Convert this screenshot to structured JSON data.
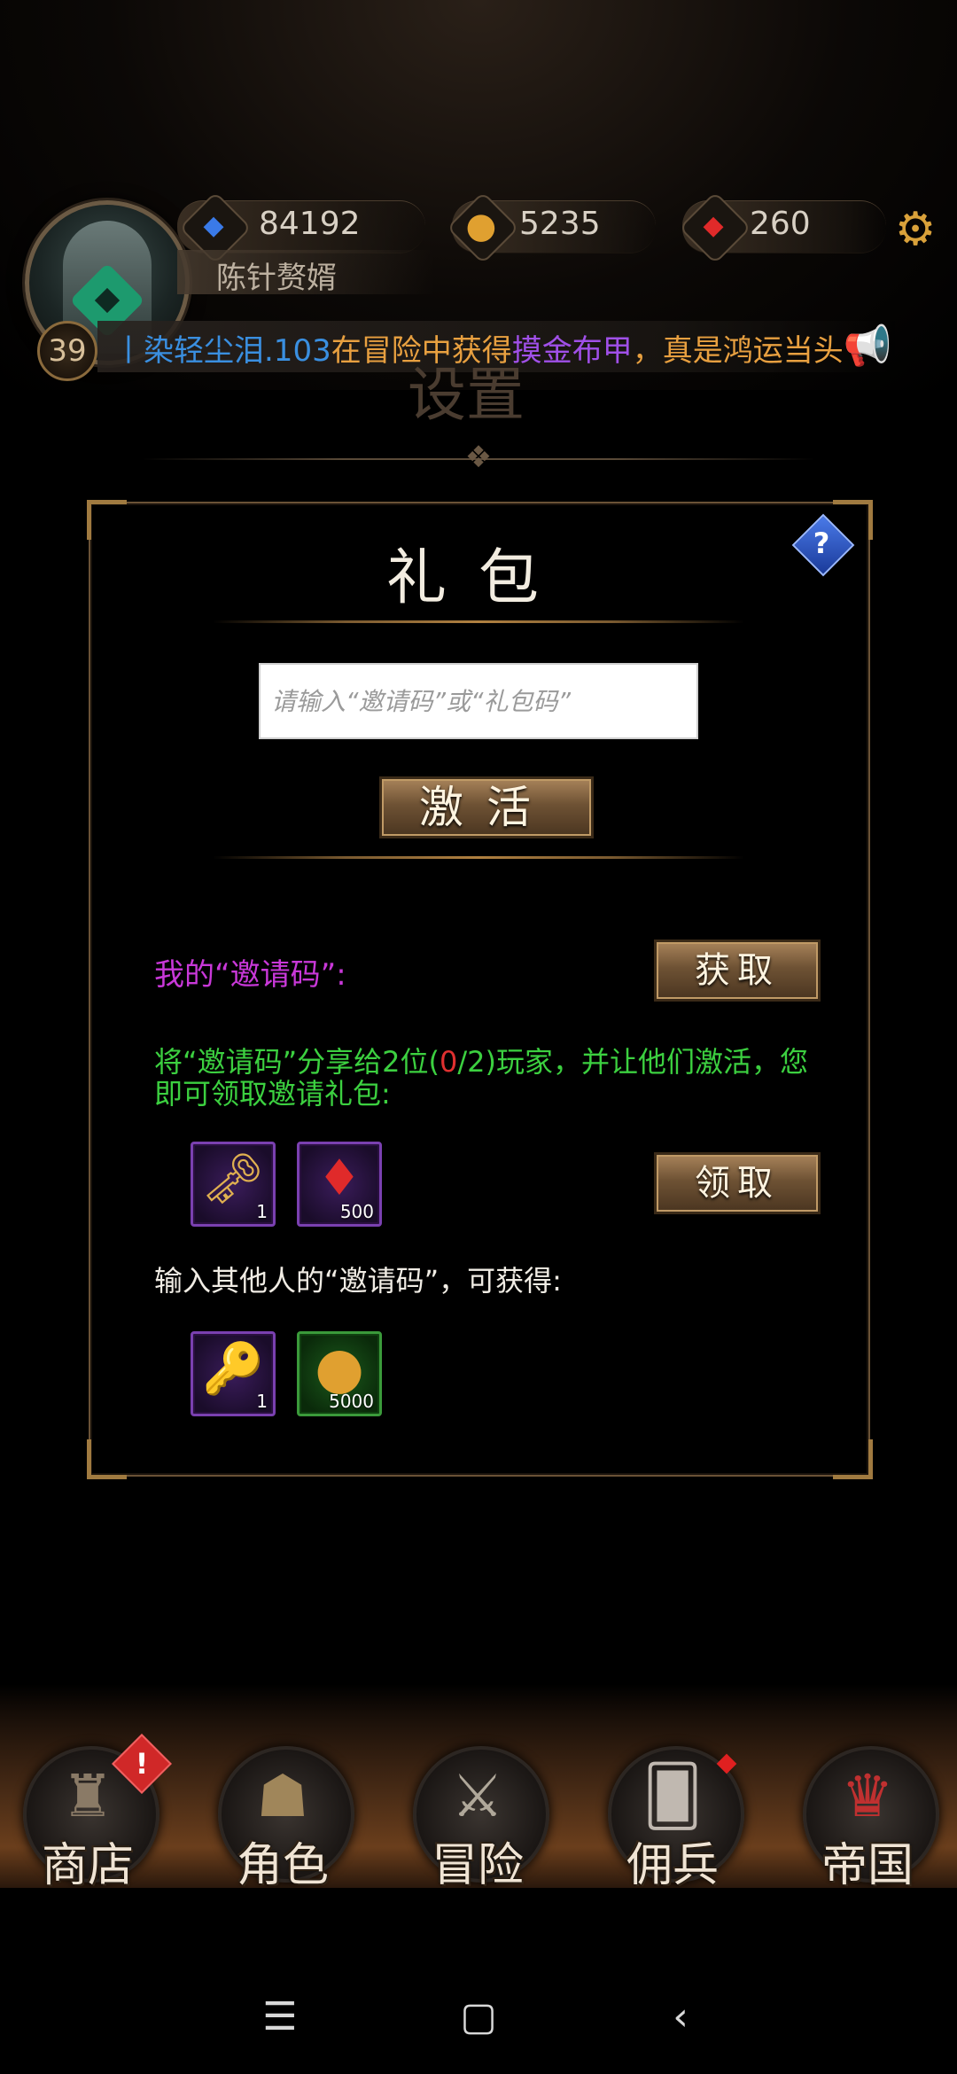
{
  "hud": {
    "level": "39",
    "username": "陈针赘婿",
    "currencies": {
      "energy": {
        "icon": "blue-gem-icon",
        "value": "84192"
      },
      "gold": {
        "icon": "gold-coin-icon",
        "value": "5235"
      },
      "ruby": {
        "icon": "red-gem-icon",
        "value": "260"
      }
    },
    "ticker": {
      "player": "丨染轻尘泪.103",
      "text1": "在冒险中获得",
      "item": "摸金布甲",
      "text2": "，真是鸿运当头"
    },
    "background_title": "设置"
  },
  "dialog": {
    "title": "礼包",
    "input_placeholder": "请输入“邀请码”或“礼包码”",
    "input_value": "",
    "activate_label": "激活",
    "my_code_label": "我的“邀请码”:",
    "get_label": "获取",
    "share_text_before": "将“邀请码”分享给2位(",
    "share_count": "0",
    "share_text_after": "/2)玩家，并让他们激活，您即可领取邀请礼包:",
    "claim_label": "领取",
    "invite_rewards": [
      {
        "icon": "keys-icon",
        "count": "1",
        "rarity": "purple"
      },
      {
        "icon": "red-gem-icon",
        "count": "500",
        "rarity": "purple"
      }
    ],
    "other_text": "输入其他人的“邀请码”，可获得:",
    "other_rewards": [
      {
        "icon": "key-icon",
        "count": "1",
        "rarity": "purple"
      },
      {
        "icon": "gold-coin-icon",
        "count": "5000",
        "rarity": "green"
      }
    ]
  },
  "nav": {
    "items": [
      {
        "label": "商店",
        "icon": "castle-icon"
      },
      {
        "label": "角色",
        "icon": "hood-icon"
      },
      {
        "label": "冒险",
        "icon": "crossed-swords-icon"
      },
      {
        "label": "佣兵",
        "icon": "cards-icon"
      },
      {
        "label": "帝国",
        "icon": "crown-icon"
      }
    ]
  },
  "colors": {
    "accent_gold": "#a07a40",
    "invite_code_label": "#c838d8",
    "share_text": "#3cd040",
    "share_count": "#e03030"
  }
}
